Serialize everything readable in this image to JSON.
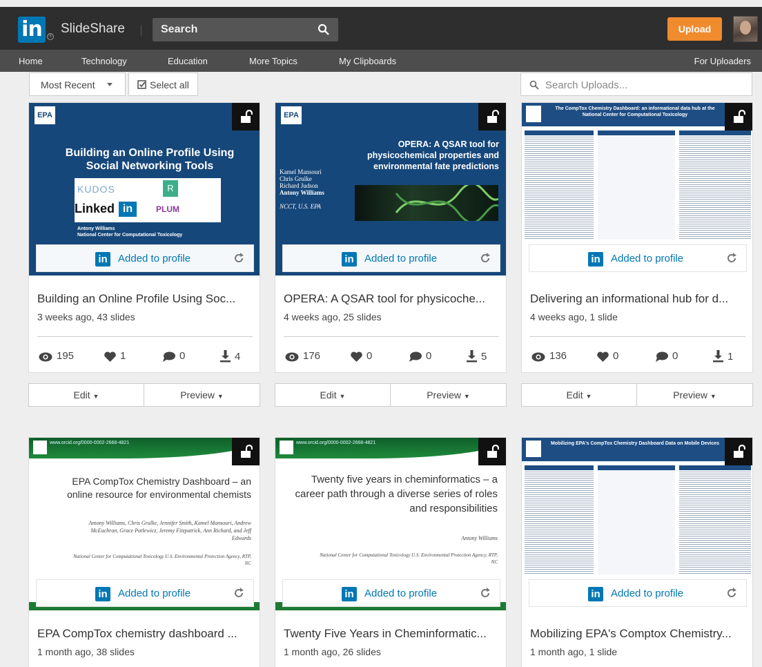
{
  "header": {
    "logo_text": "in",
    "brand": "SlideShare",
    "search_placeholder": "Search",
    "upload_label": "Upload"
  },
  "nav": {
    "items": [
      "Home",
      "Technology",
      "Education",
      "More Topics",
      "My Clipboards"
    ],
    "right": "For Uploaders"
  },
  "controls": {
    "sort_label": "Most Recent",
    "select_all_label": "Select all",
    "search_uploads_placeholder": "Search Uploads..."
  },
  "profile_badge": "Added to profile",
  "actions": {
    "edit_label": "Edit",
    "preview_label": "Preview"
  },
  "cards": [
    {
      "title": "Building an Online Profile Using Soc...",
      "meta": "3 weeks ago, 43 slides",
      "views": "195",
      "likes": "1",
      "comments": "0",
      "downloads": "4",
      "thumb": {
        "logo": "EPA",
        "title": "Building an Online Profile Using Social Networking Tools",
        "author": "Antony Williams",
        "org": "National Center for Computational Toxicology"
      }
    },
    {
      "title": "OPERA: A QSAR tool for physicoche...",
      "meta": "4 weeks ago, 25 slides",
      "views": "176",
      "likes": "0",
      "comments": "0",
      "downloads": "5",
      "thumb": {
        "logo": "EPA",
        "title": "OPERA: A QSAR tool for physicochemical properties and environmental fate predictions",
        "names": [
          "Kamel Mansouri",
          "Chris Grulke",
          "Richard Judson",
          "Antony Williams"
        ],
        "org": "NCCT, U.S. EPA"
      }
    },
    {
      "title": "Delivering an informational hub for d...",
      "meta": "4 weeks ago, 1 slide",
      "views": "136",
      "likes": "0",
      "comments": "0",
      "downloads": "1",
      "thumb": {
        "title": "The CompTox Chemistry Dashboard: an informational data hub at the National Center for Computational Toxicology"
      }
    },
    {
      "title": "EPA CompTox chemistry dashboard ...",
      "meta": "1 month ago, 38 slides",
      "thumb": {
        "url": "www.orcid.org/0000-0002-2668-4821",
        "title": "EPA CompTox Chemistry Dashboard – an online resource for environmental chemists",
        "authors": "Antony Williams, Chris Grulke, Jennifer Smith, Kamel Mansouri, Andrew McEachran, Grace Patlewicz, Jeremy Fitzpatrick, Ann Richard, and Jeff Edwards",
        "org": "National Center for Computational Toxicology U.S. Environmental Protection Agency, RTP, NC"
      }
    },
    {
      "title": "Twenty Five Years in Cheminformatic...",
      "meta": "1 month ago, 26 slides",
      "thumb": {
        "url": "www.orcid.org/0000-0002-2668-4821",
        "title": "Twenty five years in cheminformatics – a career path through a diverse series of roles and responsibilities",
        "authors": "Antony Williams",
        "org": "National Center for Computational Toxicology U.S. Environmental Protection Agency, RTP, NC"
      }
    },
    {
      "title": "Mobilizing EPA's Comptox Chemistry...",
      "meta": "1 month ago, 1 slide",
      "thumb": {
        "title": "Mobilizing EPA's CompTox Chemistry Dashboard Data on Mobile Devices"
      }
    }
  ],
  "colors": {
    "brand": "#0077b5",
    "upload": "#f08b2e",
    "topbar": "#2e2e2e",
    "navbar": "#4d4d4d"
  },
  "icons": [
    "linkedin-logo",
    "search-icon",
    "caret-down-icon",
    "check-square-icon",
    "lock-icon",
    "refresh-icon",
    "eye-icon",
    "heart-icon",
    "comment-icon",
    "download-icon"
  ]
}
